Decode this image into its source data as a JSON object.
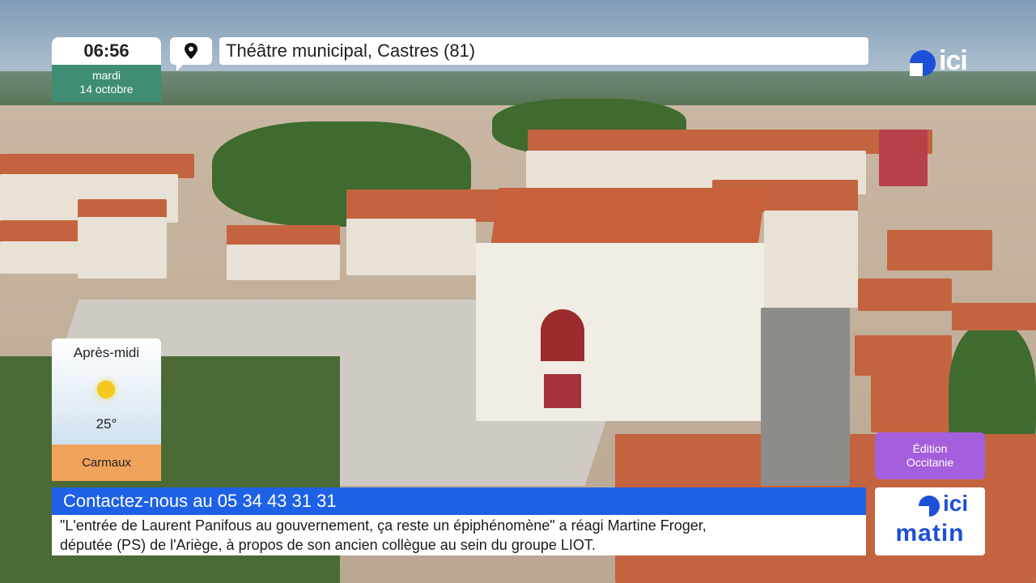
{
  "clock": {
    "time": "06:56",
    "day": "mardi",
    "date": "14 octobre"
  },
  "location": {
    "label": "Théâtre municipal, Castres (81)"
  },
  "brand": {
    "logo_text": "ici",
    "program_logo_ici": "ici",
    "program_logo_name": "matin",
    "accent": "#1d4fd8"
  },
  "weather": {
    "period": "Après-midi",
    "temperature": "25°",
    "city": "Carmaux",
    "icon": "sun-icon"
  },
  "edition": {
    "line1": "Édition",
    "line2": "Occitanie"
  },
  "ticker": {
    "contact": "Contactez-nous au 05 34 43 31 31",
    "line1": "\"L'entrée de Laurent Panifous au gouvernement, ça reste un épiphénomène\" a réagi Martine Froger,",
    "line2": "députée (PS) de l'Ariège, à propos de son ancien collègue au sein du groupe LIOT."
  }
}
